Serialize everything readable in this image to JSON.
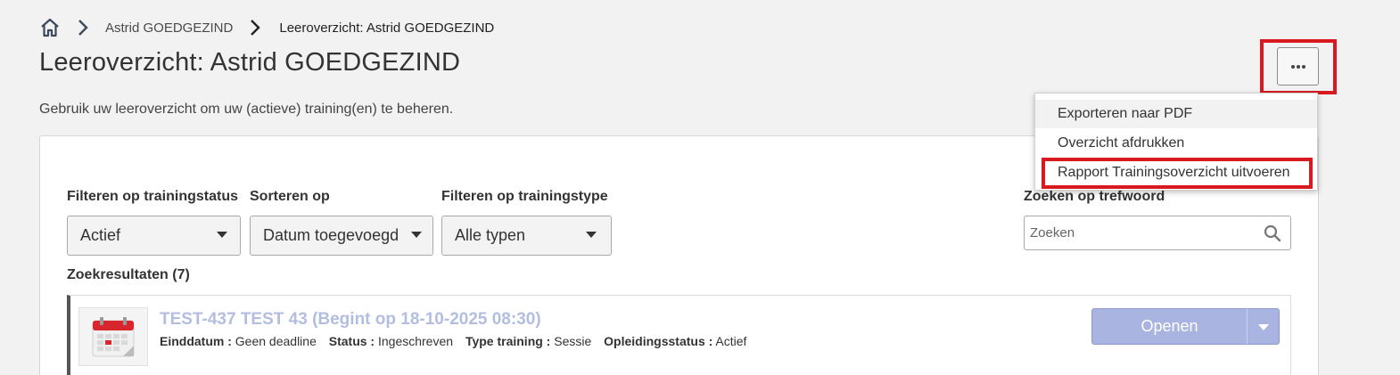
{
  "breadcrumb": {
    "items": [
      "Astrid GOEDGEZIND",
      "Leeroverzicht: Astrid GOEDGEZIND"
    ]
  },
  "page": {
    "title": "Leeroverzicht: Astrid GOEDGEZIND",
    "subtitle": "Gebruik uw leeroverzicht om uw (actieve) training(en) te beheren."
  },
  "menu": {
    "items": [
      "Exporteren naar PDF",
      "Overzicht afdrukken",
      "Rapport Trainingsoverzicht uitvoeren"
    ],
    "highlight_color": "#d8191f"
  },
  "filters": {
    "status_label": "Filteren op trainingstatus",
    "status_value": "Actief",
    "sort_label": "Sorteren op",
    "sort_value": "Datum toegevoegd",
    "type_label": "Filteren op trainingstype",
    "type_value": "Alle typen",
    "search_label": "Zoeken op trefwoord",
    "search_placeholder": "Zoeken"
  },
  "results": {
    "label": "Zoekresultaten (7)",
    "items": [
      {
        "title": "TEST-437 TEST 43 (Begint op 18-10-2025 08:30)",
        "end_date_label": "Einddatum :",
        "end_date_value": "Geen deadline",
        "status_label": "Status :",
        "status_value": "Ingeschreven",
        "type_label": "Type training :",
        "type_value": "Sessie",
        "education_status_label": "Opleidingsstatus :",
        "education_status_value": "Actief",
        "open_label": "Openen",
        "icon": "calendar-icon"
      }
    ]
  },
  "colors": {
    "accent_button": "#a9b4e0",
    "title_link": "#b3bde0",
    "annotation_red": "#d8191f"
  }
}
